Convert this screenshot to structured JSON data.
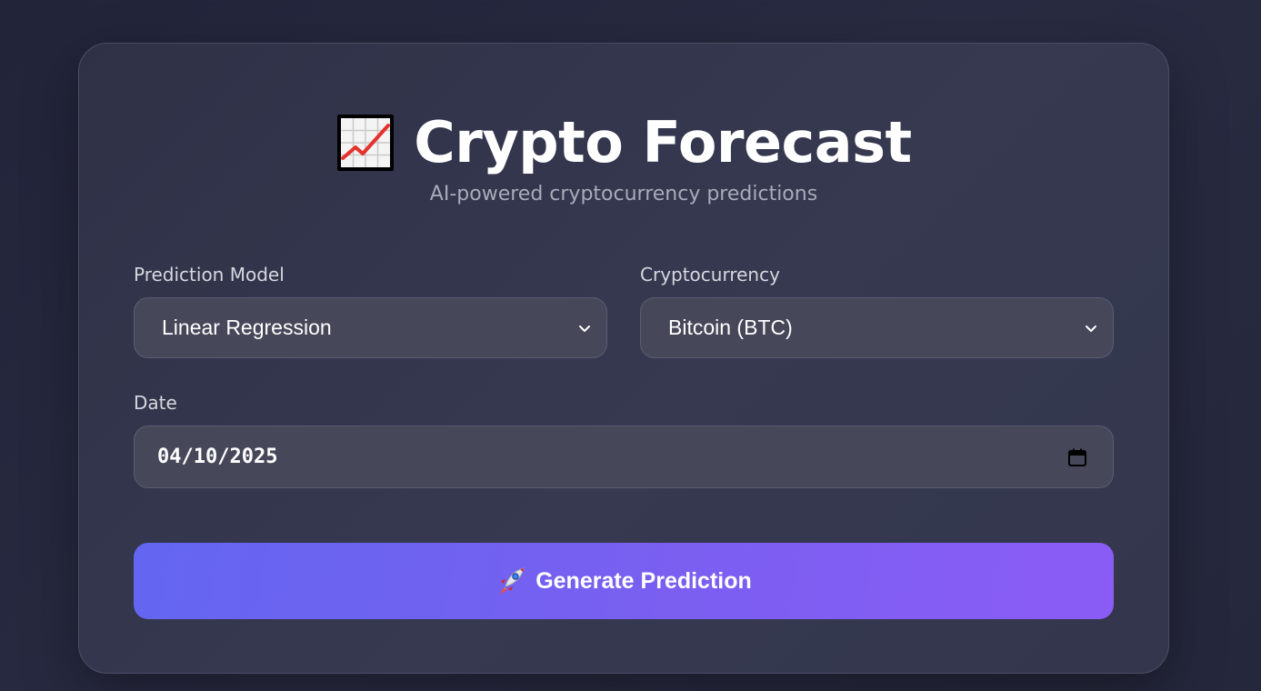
{
  "header": {
    "title": "Crypto Forecast",
    "subtitle": "AI-powered cryptocurrency predictions",
    "icon": "chart-increasing-icon"
  },
  "form": {
    "model": {
      "label": "Prediction Model",
      "selected": "Linear Regression"
    },
    "crypto": {
      "label": "Cryptocurrency",
      "selected": "Bitcoin (BTC)"
    },
    "date": {
      "label": "Date",
      "value": "04/10/2025"
    }
  },
  "action": {
    "label": "Generate Prediction",
    "icon": "rocket-icon"
  },
  "colors": {
    "background": "#23253a",
    "card": "#33364d",
    "input": "#464859",
    "button_start": "#6366f1",
    "button_end": "#8b5cf6"
  }
}
